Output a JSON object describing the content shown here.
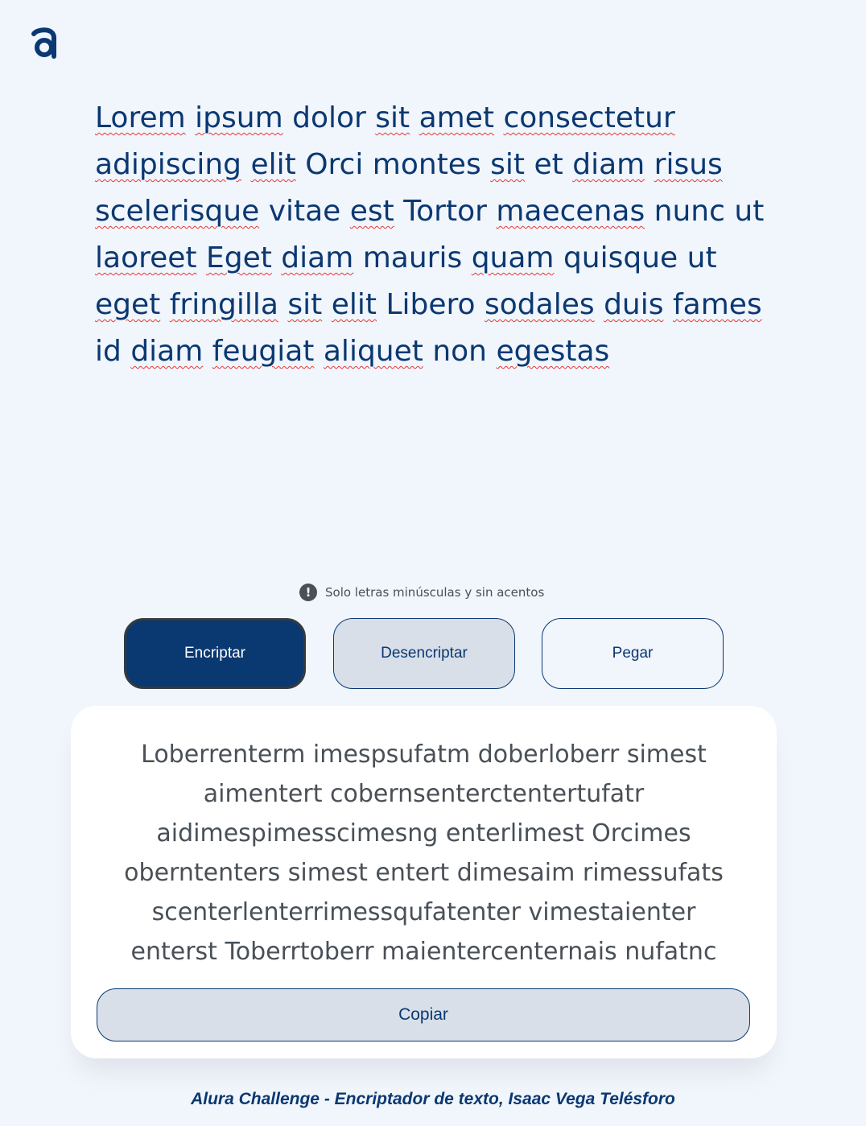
{
  "logo": {
    "icon": "alura-logo-icon"
  },
  "input": {
    "words": [
      "Lorem",
      "ipsum",
      "dolor",
      "sit",
      "amet",
      "consectetur",
      "adipiscing",
      "elit",
      "Orci",
      "montes",
      "sit",
      "et",
      "diam",
      "risus",
      "scelerisque",
      "vitae",
      "est",
      "Tortor",
      "maecenas",
      "nunc",
      "ut",
      "laoreet",
      "Eget",
      "diam",
      "mauris",
      "quam",
      "quisque",
      "ut",
      "eget",
      "fringilla",
      "sit",
      "elit",
      "Libero",
      "sodales",
      "duis",
      "fames",
      "id",
      "diam",
      "feugiat",
      "aliquet",
      "non",
      "egestas"
    ],
    "misspelled": [
      "Lorem",
      "ipsum",
      "sit",
      "amet",
      "consectetur",
      "adipiscing",
      "elit",
      "diam",
      "risus",
      "scelerisque",
      "est",
      "maecenas",
      "laoreet",
      "Eget",
      "quam",
      "eget",
      "fringilla",
      "sodales",
      "duis",
      "fames",
      "feugiat",
      "aliquet",
      "egestas"
    ]
  },
  "hint": {
    "icon": "exclamation-icon",
    "text": "Solo letras minúsculas y sin acentos"
  },
  "buttons": {
    "encrypt": "Encriptar",
    "decrypt": "Desencriptar",
    "paste": "Pegar"
  },
  "output": {
    "text": "Loberrenterm imespsufatm doberloberr simest\naimentert cobernsenterctentertufatr\naidimespimesscimesng enterlimest Orcimes\noberntenters simest entert dimesaim rimessufats\nscenterlenterrimessqufatenter vimestaienter\nenterst Toberrtoberr maientercenternais nufatnc",
    "copy_label": "Copiar"
  },
  "footer": "Alura Challenge - Encriptador de texto, Isaac Vega Telésforo",
  "colors": {
    "background": "#F1F5FC",
    "primary": "#0A3871",
    "muted_text": "#495057",
    "secondary_button": "#D8DFE8",
    "spellcheck": "#E53935"
  }
}
